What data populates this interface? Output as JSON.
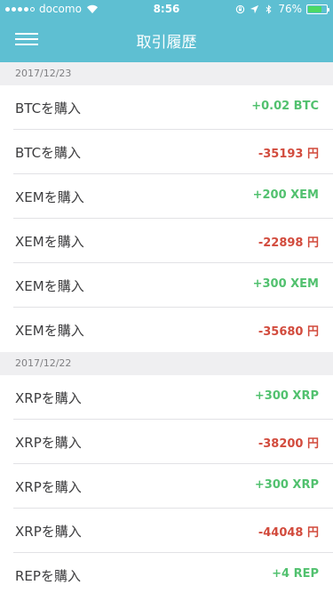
{
  "status_bar": {
    "carrier": "docomo",
    "time": "8:56",
    "battery_percent": "76%",
    "battery_level": 0.76
  },
  "nav": {
    "title": "取引履歴"
  },
  "colors": {
    "header": "#5ebfd2",
    "positive": "#52c16f",
    "negative": "#d24b3d",
    "section_bg": "#efeff1"
  },
  "sections": [
    {
      "date": "2017/12/23",
      "items": [
        {
          "label": "BTCを購入",
          "amount": "+0.02 BTC",
          "type": "pos"
        },
        {
          "label": "BTCを購入",
          "amount": "-35193 円",
          "type": "neg"
        },
        {
          "label": "XEMを購入",
          "amount": "+200 XEM",
          "type": "pos"
        },
        {
          "label": "XEMを購入",
          "amount": "-22898 円",
          "type": "neg"
        },
        {
          "label": "XEMを購入",
          "amount": "+300 XEM",
          "type": "pos"
        },
        {
          "label": "XEMを購入",
          "amount": "-35680 円",
          "type": "neg"
        }
      ]
    },
    {
      "date": "2017/12/22",
      "items": [
        {
          "label": "XRPを購入",
          "amount": "+300 XRP",
          "type": "pos"
        },
        {
          "label": "XRPを購入",
          "amount": "-38200 円",
          "type": "neg"
        },
        {
          "label": "XRPを購入",
          "amount": "+300 XRP",
          "type": "pos"
        },
        {
          "label": "XRPを購入",
          "amount": "-44048 円",
          "type": "neg"
        },
        {
          "label": "REPを購入",
          "amount": "+4 REP",
          "type": "pos"
        }
      ]
    }
  ]
}
